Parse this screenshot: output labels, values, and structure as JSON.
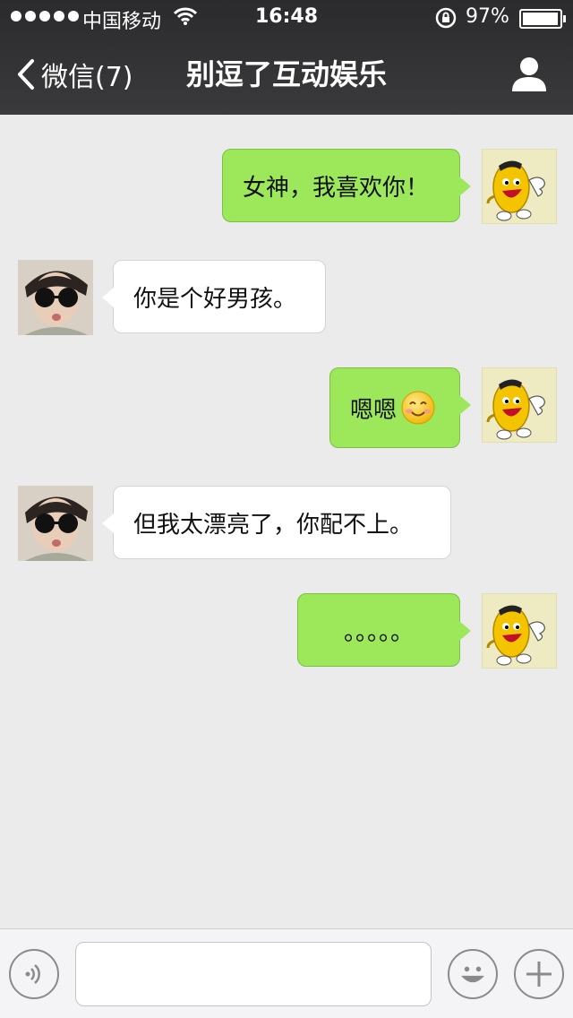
{
  "status_bar": {
    "carrier": "中国移动",
    "time": "16:48",
    "battery_percent": "97%",
    "battery_level": 0.97,
    "signal_dots": 5
  },
  "nav": {
    "back_label": "微信(7)",
    "title": "别逗了互动娱乐",
    "profile_icon": "person-icon"
  },
  "messages": [
    {
      "direction": "out",
      "text": "女神，我喜欢你！"
    },
    {
      "direction": "in",
      "text": "你是个好男孩。"
    },
    {
      "direction": "out",
      "text": "嗯嗯",
      "emoji": "smiling-face-icon"
    },
    {
      "direction": "in",
      "text": "但我太漂亮了，你配不上。"
    },
    {
      "direction": "out",
      "text": "。。。。。"
    }
  ],
  "input_bar": {
    "voice_icon": "voice-icon",
    "emoji_icon": "emoji-icon",
    "plus_icon": "plus-icon",
    "text_value": ""
  },
  "colors": {
    "outgoing_bubble": "#9de75a",
    "incoming_bubble": "#ffffff",
    "background": "#ebebeb",
    "header": "#2f2f31"
  }
}
